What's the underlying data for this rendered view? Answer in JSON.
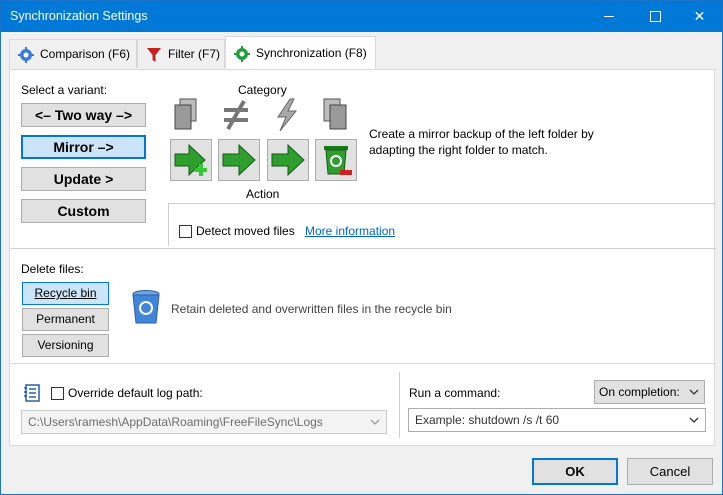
{
  "window": {
    "title": "Synchronization Settings",
    "minimize": "–",
    "maximize": "□",
    "close": "✕"
  },
  "tabs": [
    {
      "label": "Comparison (F6)",
      "icon": "gear-blue-icon"
    },
    {
      "label": "Filter (F7)",
      "icon": "funnel-icon"
    },
    {
      "label": "Synchronization (F8)",
      "icon": "gear-green-icon",
      "active": true
    }
  ],
  "variant": {
    "heading": "Select a variant:",
    "options": [
      "<– Two way –>",
      "Mirror –>",
      "Update >",
      "Custom"
    ],
    "selected": "Mirror –>"
  },
  "category": {
    "heading": "Category",
    "action_label": "Action"
  },
  "description": {
    "line1": "Create a mirror backup of the left folder by",
    "line2": "adapting the right folder to match."
  },
  "detect_moved": {
    "label": "Detect moved files",
    "checked": false,
    "link": "More information"
  },
  "delete_files": {
    "heading": "Delete files:",
    "options": [
      "Recycle bin",
      "Permanent",
      "Versioning"
    ],
    "selected": "Recycle bin",
    "description": "Retain deleted and overwritten files in the recycle bin"
  },
  "log": {
    "override_label": "Override default log path:",
    "checked": false,
    "path": "C:\\Users\\ramesh\\AppData\\Roaming\\FreeFileSync\\Logs"
  },
  "command": {
    "label": "Run a command:",
    "trigger": "On completion:",
    "placeholder": "Example: shutdown /s /t 60"
  },
  "buttons": {
    "ok": "OK",
    "cancel": "Cancel"
  },
  "colors": {
    "accent": "#0078d7",
    "link": "#0066cc",
    "action_green": "#2e9e2e",
    "delete_red": "#d02020"
  }
}
